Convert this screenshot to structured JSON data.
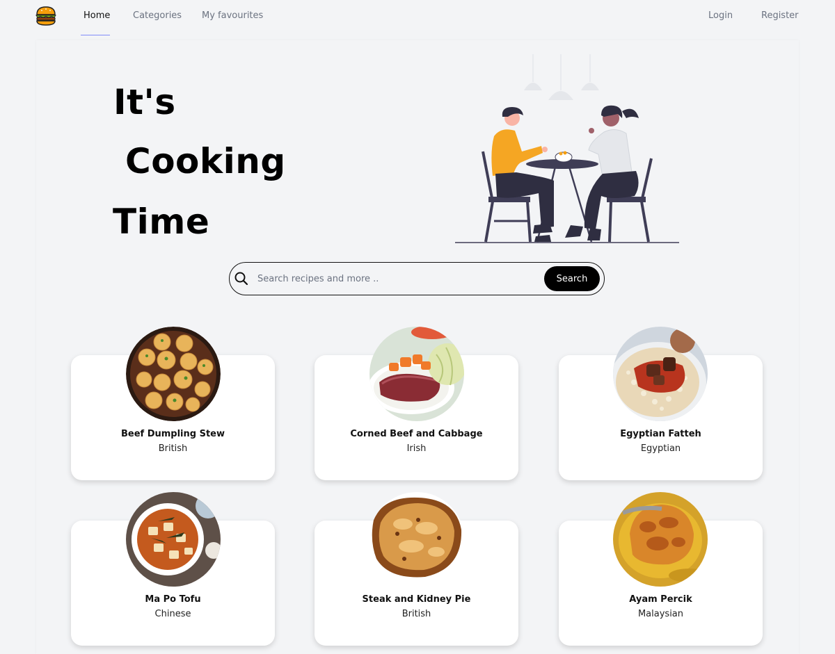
{
  "nav": {
    "links": [
      "Home",
      "Categories",
      "My favourites"
    ],
    "login": "Login",
    "register": "Register"
  },
  "hero": {
    "lines": [
      "It's",
      "Cooking",
      "Time"
    ]
  },
  "search": {
    "placeholder": "Search recipes and more ..",
    "button": "Search"
  },
  "recipes": [
    {
      "name": "Beef Dumpling Stew",
      "cuisine": "British"
    },
    {
      "name": "Corned Beef and Cabbage",
      "cuisine": "Irish"
    },
    {
      "name": "Egyptian Fatteh",
      "cuisine": "Egyptian"
    },
    {
      "name": "Ma Po Tofu",
      "cuisine": "Chinese"
    },
    {
      "name": "Steak and Kidney Pie",
      "cuisine": "British"
    },
    {
      "name": "Ayam Percik",
      "cuisine": "Malaysian"
    }
  ],
  "colors": {
    "background": "#f3f4f6",
    "accent_underline": "#818cf8",
    "button": "#000000",
    "illustration_yellow": "#f5a623"
  }
}
